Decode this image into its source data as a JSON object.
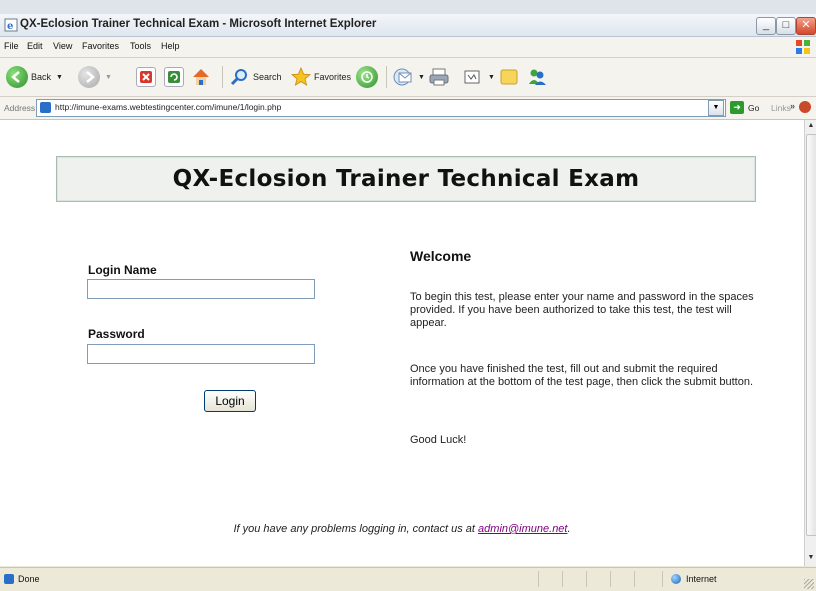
{
  "window": {
    "title": "QX-Eclosion Trainer Technical Exam - Microsoft Internet Explorer",
    "controls": {
      "minimize": "_",
      "maximize": "□",
      "close": "✕"
    }
  },
  "menu": {
    "items": [
      "File",
      "Edit",
      "View",
      "Favorites",
      "Tools",
      "Help"
    ]
  },
  "toolbar": {
    "back_label": "Back",
    "search_label": "Search",
    "favorites_label": "Favorites"
  },
  "address": {
    "label": "Address",
    "url": "http://imune-exams.webtestingcenter.com/imune/1/login.php",
    "go_label": "Go",
    "links_label": "Links"
  },
  "page": {
    "heading": "QX-Eclosion Trainer Technical Exam",
    "login_name_label": "Login Name",
    "password_label": "Password",
    "login_name_value": "",
    "password_value": "",
    "login_button": "Login",
    "welcome_title": "Welcome",
    "paragraphs": [
      "To begin this test, please enter your name and password in the spaces provided. If you have been authorized to take this test, the test will appear.",
      "Once you have finished the test, fill out and submit the required information at the bottom of the test page, then click the submit button.",
      "Good Luck!"
    ],
    "footer_text": "If you have any problems logging in, contact us at ",
    "footer_link": "admin@imune.net",
    "footer_end": "."
  },
  "status": {
    "text": "Done",
    "zone": "Internet"
  },
  "colors": {
    "link_visited": "#800080",
    "header_bg": "#eff1ef",
    "xp_blue": "#2a6fc7"
  }
}
